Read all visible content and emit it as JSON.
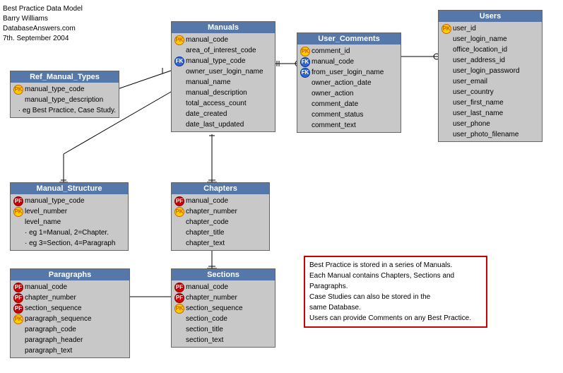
{
  "diagram": {
    "title": "Best Practice Data Model",
    "author": "Barry Williams",
    "website": "DatabaseAnswers.com",
    "date": "7th. September 2004"
  },
  "entities": {
    "manuals": {
      "title": "Manuals",
      "fields": [
        {
          "type": "pk",
          "label": "manual_code"
        },
        {
          "type": "none",
          "label": "area_of_interest_code"
        },
        {
          "type": "fk",
          "label": "manual_type_code"
        },
        {
          "type": "none",
          "label": "owner_user_login_name"
        },
        {
          "type": "none",
          "label": "manual_name"
        },
        {
          "type": "none",
          "label": "manual_description"
        },
        {
          "type": "none",
          "label": "total_access_count"
        },
        {
          "type": "none",
          "label": "date_created"
        },
        {
          "type": "none",
          "label": "date_last_updated"
        }
      ]
    },
    "users": {
      "title": "Users",
      "fields": [
        {
          "type": "pk",
          "label": "user_id"
        },
        {
          "type": "none",
          "label": "user_login_name"
        },
        {
          "type": "none",
          "label": "office_location_id"
        },
        {
          "type": "none",
          "label": "user_address_id"
        },
        {
          "type": "none",
          "label": "user_login_password"
        },
        {
          "type": "none",
          "label": "user_email"
        },
        {
          "type": "none",
          "label": "user_country"
        },
        {
          "type": "none",
          "label": "user_first_name"
        },
        {
          "type": "none",
          "label": "user_last_name"
        },
        {
          "type": "none",
          "label": "user_phone"
        },
        {
          "type": "none",
          "label": "user_photo_filename"
        }
      ]
    },
    "user_comments": {
      "title": "User_Comments",
      "fields": [
        {
          "type": "pk",
          "label": "comment_id"
        },
        {
          "type": "fk",
          "label": "manual_code"
        },
        {
          "type": "fk",
          "label": "from_user_login_name"
        },
        {
          "type": "none",
          "label": "owner_action_date"
        },
        {
          "type": "none",
          "label": "owner_action"
        },
        {
          "type": "none",
          "label": "comment_date"
        },
        {
          "type": "none",
          "label": "comment_status"
        },
        {
          "type": "none",
          "label": "comment_text"
        }
      ]
    },
    "ref_manual_types": {
      "title": "Ref_Manual_Types",
      "fields": [
        {
          "type": "pk",
          "label": "manual_type_code"
        },
        {
          "type": "none",
          "label": "manual_type_description"
        },
        {
          "type": "none",
          "label": "· eg Best Practice, Case Study."
        }
      ]
    },
    "manual_structure": {
      "title": "Manual_Structure",
      "fields": [
        {
          "type": "pf",
          "label": "manual_type_code"
        },
        {
          "type": "pk",
          "label": "level_number"
        },
        {
          "type": "none",
          "label": "level_name"
        },
        {
          "type": "none",
          "label": "· eg 1=Manual, 2=Chapter."
        },
        {
          "type": "none",
          "label": "· eg 3=Section, 4=Paragraph"
        }
      ]
    },
    "chapters": {
      "title": "Chapters",
      "fields": [
        {
          "type": "pf",
          "label": "manual_code"
        },
        {
          "type": "pk",
          "label": "chapter_number"
        },
        {
          "type": "none",
          "label": "chapter_code"
        },
        {
          "type": "none",
          "label": "chapter_title"
        },
        {
          "type": "none",
          "label": "chapter_text"
        }
      ]
    },
    "sections": {
      "title": "Sections",
      "fields": [
        {
          "type": "pf",
          "label": "manual_code"
        },
        {
          "type": "pf",
          "label": "chapter_number"
        },
        {
          "type": "pk",
          "label": "section_sequence"
        },
        {
          "type": "none",
          "label": "section_code"
        },
        {
          "type": "none",
          "label": "section_title"
        },
        {
          "type": "none",
          "label": "section_text"
        }
      ]
    },
    "paragraphs": {
      "title": "Paragraphs",
      "fields": [
        {
          "type": "pf",
          "label": "manual_code"
        },
        {
          "type": "pf",
          "label": "chapter_number"
        },
        {
          "type": "pf",
          "label": "section_sequence"
        },
        {
          "type": "pk",
          "label": "paragraph_sequence"
        },
        {
          "type": "none",
          "label": "paragraph_code"
        },
        {
          "type": "none",
          "label": "paragraph_header"
        },
        {
          "type": "none",
          "label": "paragraph_text"
        }
      ]
    }
  },
  "note": {
    "lines": [
      "Best Practice is stored in a series of Manuals.",
      "Each Manual contains Chapters, Sections and Paragraphs.",
      "Case Studies can also be stored in the",
      "same Database.",
      "Users can provide Comments on any Best Practice."
    ]
  }
}
